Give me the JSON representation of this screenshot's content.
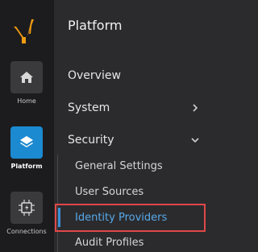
{
  "rail": {
    "items": [
      {
        "label": "Home",
        "icon": "home-icon"
      },
      {
        "label": "Platform",
        "icon": "layers-icon",
        "active": true
      },
      {
        "label": "Connections",
        "icon": "connections-icon"
      }
    ]
  },
  "panel": {
    "title": "Platform",
    "items": [
      {
        "label": "Overview"
      },
      {
        "label": "System",
        "chevron": "chevron-right-icon"
      },
      {
        "label": "Security",
        "chevron": "chevron-down-icon",
        "expanded": true
      }
    ],
    "security_children": [
      {
        "label": "General Settings"
      },
      {
        "label": "User Sources"
      },
      {
        "label": "Identity Providers",
        "active": true
      },
      {
        "label": "Audit Profiles"
      }
    ]
  },
  "colors": {
    "rail_bg": "#1c1c1e",
    "panel_bg": "#2b2b2e",
    "accent": "#1c8ad1",
    "logo": "#f39c12",
    "active_text": "#57a9e9",
    "highlight_border": "#e04848"
  }
}
